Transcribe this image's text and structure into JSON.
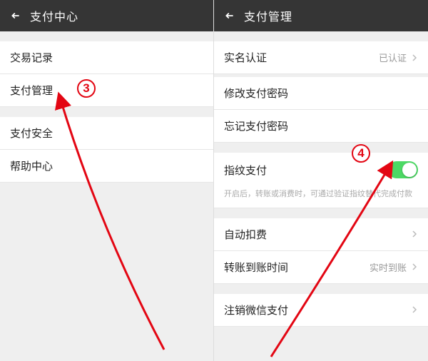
{
  "left": {
    "title": "支付中心",
    "items": {
      "transactions": "交易记录",
      "paymentManagement": "支付管理",
      "paymentSecurity": "支付安全",
      "helpCenter": "帮助中心"
    }
  },
  "right": {
    "title": "支付管理",
    "realName": {
      "label": "实名认证",
      "status": "已认证"
    },
    "changePwd": "修改支付密码",
    "forgotPwd": "忘记支付密码",
    "fingerprint": {
      "label": "指纹支付",
      "enabled": true,
      "desc": "开启后，转账或消费时，可通过验证指纹替代完成付款"
    },
    "autoDeduct": "自动扣费",
    "transferTiming": {
      "label": "转账到账时间",
      "value": "实时到账"
    },
    "deregister": "注销微信支付"
  },
  "annotations": {
    "step3": "3",
    "step4": "4"
  }
}
